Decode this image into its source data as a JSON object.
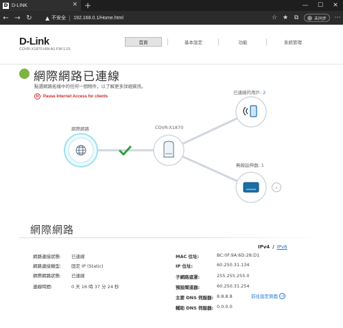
{
  "browser": {
    "tab_favicon": "D",
    "tab_title": "D-LINK",
    "new_tab_symbol": "+",
    "insecure_label": "不安全",
    "url": "192.168.0.1/Home.html",
    "sync_label": "未同步"
  },
  "header": {
    "logo": "D-Link",
    "model_info": "COVR-X1870 HW:A1 FW:1.01",
    "menu": [
      {
        "label": "首頁",
        "active": true
      },
      {
        "label": "基本設定",
        "active": false
      },
      {
        "label": "功能",
        "active": false
      },
      {
        "label": "系統管理",
        "active": false
      }
    ]
  },
  "status": {
    "title": "網際網路已連線",
    "description": "點選網路拓樸中的任何一個物件，以了解更多詳細資訊。",
    "pause_label": "Pause Internet Access for clients",
    "color": "#7cb342"
  },
  "topology": {
    "internet_label": "網際網路",
    "router_label": "COVR-X1870",
    "clients_label": "已連線的用戶:",
    "clients_count": "2",
    "extenders_label": "無線延伸器:",
    "extenders_count": "1",
    "connection_ok_color": "#2e9e3e",
    "internet_icon": "globe-icon",
    "router_icon": "router-icon",
    "client_icon": "phone-wifi-icon",
    "extender_icon": "extender-icon"
  },
  "internet": {
    "section_title": "網際網路",
    "ipv4_label": "IPv4",
    "ipv6_label": "IPv6",
    "left": [
      {
        "label": "網路連接狀態:",
        "value": "已連線"
      },
      {
        "label": "網路連接類型:",
        "value": "固定 IP (Static)"
      },
      {
        "label": "網際網路狀態:",
        "value": "已連線"
      },
      {
        "label": "連線時間:",
        "value": "0 天 16 時 37 分 24 秒"
      }
    ],
    "right": [
      {
        "label": "MAC 位址:",
        "value": "BC:0F:9A:6D:28:D1"
      },
      {
        "label": "IP 位址:",
        "value": "60.250.31.134"
      },
      {
        "label": "子網路遮罩:",
        "value": "255.255.255.0"
      },
      {
        "label": "預設閘道器:",
        "value": "60.250.31.254"
      },
      {
        "label": "主要 DNS 伺服器:",
        "value": "8.8.8.8"
      },
      {
        "label": "輔助 DNS 伺服器:",
        "value": "0.0.0.0"
      }
    ],
    "goto_label": "前往設定頁面"
  }
}
